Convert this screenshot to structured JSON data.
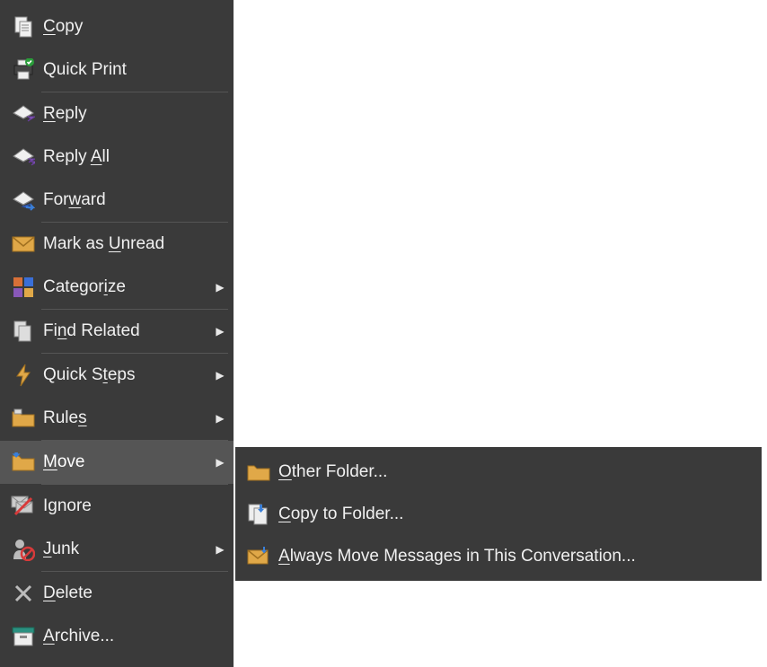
{
  "contextMenu": {
    "items": [
      {
        "id": "copy",
        "pre": "",
        "accel": "C",
        "post": "opy",
        "submenu": false
      },
      {
        "id": "quickprint",
        "pre": "Quick ",
        "accel": "",
        "post": "Print",
        "submenu": false,
        "sep": true
      },
      {
        "id": "reply",
        "pre": "",
        "accel": "R",
        "post": "eply",
        "submenu": false
      },
      {
        "id": "replyall",
        "pre": "Reply ",
        "accel": "A",
        "post": "ll",
        "submenu": false
      },
      {
        "id": "forward",
        "pre": "For",
        "accel": "w",
        "post": "ard",
        "submenu": false,
        "sep": true
      },
      {
        "id": "markunread",
        "pre": "Mark as ",
        "accel": "U",
        "post": "nread",
        "submenu": false
      },
      {
        "id": "categorize",
        "pre": "Categor",
        "accel": "i",
        "post": "ze",
        "submenu": true,
        "itemSep": true
      },
      {
        "id": "findrelated",
        "pre": "Fi",
        "accel": "n",
        "post": "d Related",
        "submenu": true,
        "sep": true
      },
      {
        "id": "quicksteps",
        "pre": "Quick S",
        "accel": "t",
        "post": "eps",
        "submenu": true
      },
      {
        "id": "rules",
        "pre": "Rule",
        "accel": "s",
        "post": "",
        "submenu": true,
        "sep": true
      },
      {
        "id": "move",
        "pre": "",
        "accel": "M",
        "post": "ove",
        "submenu": true,
        "hovered": true,
        "sep": true
      },
      {
        "id": "ignore",
        "pre": "Ignore",
        "accel": "",
        "post": "",
        "submenu": false
      },
      {
        "id": "junk",
        "pre": "",
        "accel": "J",
        "post": "unk",
        "submenu": true,
        "sep": true
      },
      {
        "id": "delete",
        "pre": "",
        "accel": "D",
        "post": "elete",
        "submenu": false
      },
      {
        "id": "archive",
        "pre": "",
        "accel": "A",
        "post": "rchive...",
        "submenu": false
      }
    ]
  },
  "moveSubmenu": {
    "items": [
      {
        "id": "otherfolder",
        "pre": "",
        "accel": "O",
        "post": "ther Folder..."
      },
      {
        "id": "copyfolder",
        "pre": "",
        "accel": "C",
        "post": "opy to Folder..."
      },
      {
        "id": "alwaysmove",
        "pre": "",
        "accel": "A",
        "post": "lways Move Messages in This Conversation..."
      }
    ]
  }
}
